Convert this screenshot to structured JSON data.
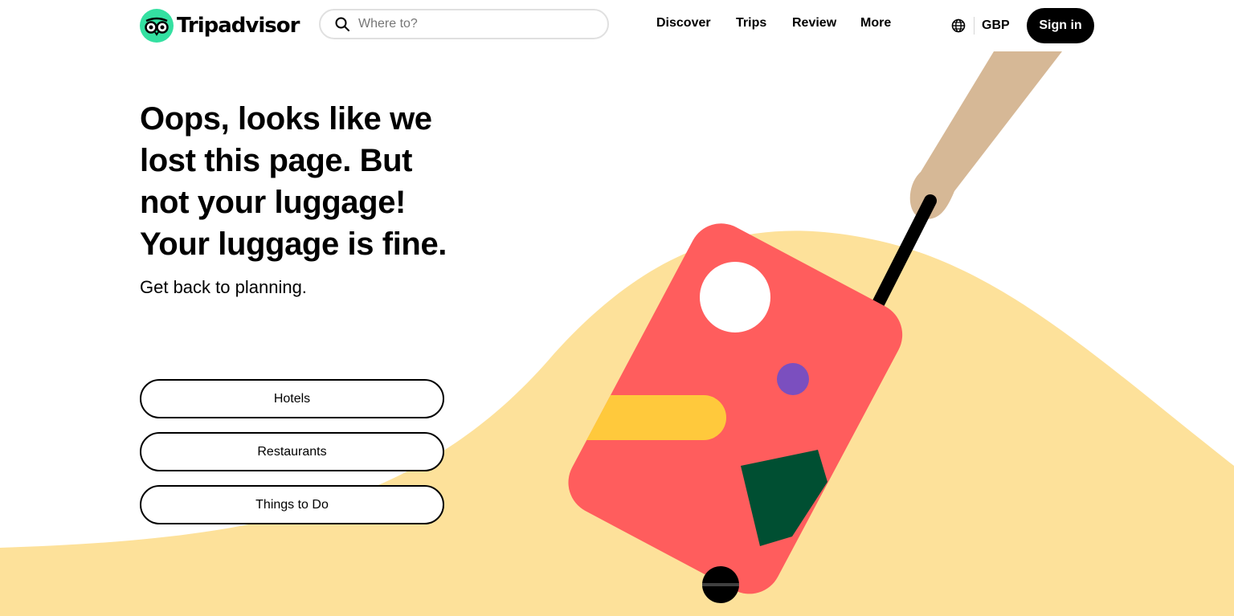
{
  "header": {
    "brand": "Tripadvisor",
    "search": {
      "placeholder": "Where to?",
      "value": ""
    },
    "nav": [
      "Discover",
      "Trips",
      "Review",
      "More"
    ],
    "currency": "GBP",
    "sign_in_label": "Sign in"
  },
  "main": {
    "headline": "Oops, looks like we lost this page. But not your luggage! Your luggage is fine.",
    "subheading": "Get back to planning.",
    "links": [
      "Hotels",
      "Restaurants",
      "Things to Do"
    ]
  },
  "icons": {
    "logo": "owl-logo-icon",
    "search": "search-icon",
    "language": "globe-icon"
  },
  "colors": {
    "brand_green": "#34e0a1",
    "suitcase_red": "#ff5d5d",
    "sand": "#fde19a",
    "yellow_stripe": "#ffc93c",
    "purple_dot": "#7b4fbf",
    "green_patch": "#004f32",
    "arm": "#d6b896",
    "button_dark": "#000000"
  }
}
